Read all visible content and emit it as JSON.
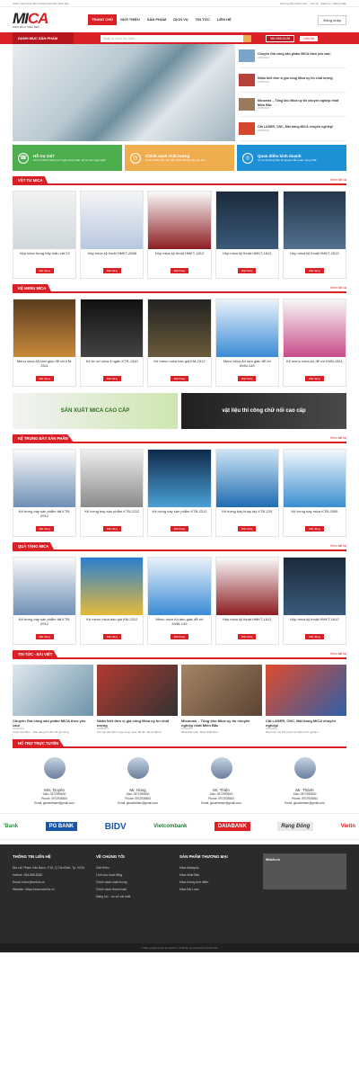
{
  "topbar": {
    "tagline": "Chào mừng bạn đến với thế giới biển Mica đẹp",
    "links": "Hướng dẫn thanh toán · Liên hệ · Đăng ký · Đăng nhập"
  },
  "logo": {
    "brand_a": "MI",
    "brand_b": "CA",
    "sub": "BIỂN MICA SIÊU ĐẸP"
  },
  "nav": [
    "TRANG CHỦ",
    "GIỚI THIỆU",
    "SẢN PHẨM",
    "DỊCH VỤ",
    "TIN TỨC",
    "LIÊN HỆ"
  ],
  "login_label": "Đăng nhập",
  "categories_label": "DANH MỤC SẢN PHẨM",
  "search_placeholder": "Nhập từ khóa tìm kiếm...",
  "hotline": "084.888.83.85",
  "cta": "Liên hệ",
  "sidenews": [
    {
      "title": "Chuyên Gia công sản phẩm MICA theo yêu cầu!",
      "date": "20/08/2019"
    },
    {
      "title": "Nhận biết đơn vị gia công Mica uy tín chất lượng",
      "date": "20/08/2019"
    },
    {
      "title": "Micomax – Tổng kho Mica uy tín chuyên nghiệp nhất Miền Bắc",
      "date": "20/08/2019"
    },
    {
      "title": "Cắt LASER, CNC, Mài bóng MICA chuyên nghiệp!",
      "date": "20/08/2019"
    }
  ],
  "features": [
    {
      "title": "Hỗ trợ 24/7",
      "desc": "Hỗ trợ khách hàng mọi ngày trong tuần, kể cả các ngày nghỉ"
    },
    {
      "title": "Chính sách chất lượng",
      "desc": "Hoàn 100% tiền nếu sản phẩm không đạt yêu cầu"
    },
    {
      "title": "Quan điểm kinh doanh",
      "desc": "Uy tín thương hiệu là nguyên tắc quan trọng nhất"
    }
  ],
  "more": "Xem tất cả",
  "order": "Đặt hàng",
  "sections": [
    {
      "title": "VẬT TƯ MICA",
      "items": [
        "Hộp mica trưng bày mẫu vật 23",
        "Hộp mica kỹ thuật HMKT-2808",
        "Hộp mica kỹ thuật HMKT-1812",
        "Hộp mica kỹ thuật HMKT-1612",
        "Hộp mica kỹ thuật HMKT-2512"
      ]
    },
    {
      "title": "KỆ MENU MICA",
      "items": [
        "Menu mica A5 tam giác để rời KM-2511",
        "Kệ tờ rơi mica 4 ngăn KTR-1510",
        "Kệ menu mica báo giá KM-2312",
        "Menu mica A4 tam giác để rời KMN-149",
        "Kệ menu mica A4 để rời KMN-2811"
      ]
    },
    {
      "title": "KỆ TRƯNG BÀY SẢN PHẨM",
      "items": [
        "Kệ trưng bày sản phẩm tất KTB-0912",
        "Kệ trưng bày sản phẩm KTB-2212",
        "Kệ trưng bày sản phẩm KTB-2312",
        "Kệ trưng bày khay tày KTB-225",
        "Kệ trưng bày mica KTB-2509"
      ]
    },
    {
      "title": "QUÀ TẶNG MICA",
      "items": [
        "Kệ trưng bày sản phẩm tất KTB-0912",
        "Kệ menu mica báo giá KM-2312",
        "Menu mica A4 tam giác để rời KMN-149",
        "Hộp mica kỹ thuật HMKT-1812",
        "Hộp mica kỹ thuật HMKT-1612"
      ]
    }
  ],
  "banners": [
    "SẢN XUẤT MICA CAO CẤP",
    "vật liệu thi công chữ nổi cao cấp"
  ],
  "news_title": "TIN TỨC - BÀI VIẾT",
  "news": [
    {
      "title": "Chuyên Gia công sản phẩm MICA theo yêu cầu!",
      "date": "20/08/2019",
      "snip": "Chào Các Bạn – Bạn đang tìm địa chỉ gia công..."
    },
    {
      "title": "Nhận biết đơn vị gia công Mica uy tín chất lượng",
      "date": "20/08/2019",
      "snip": "Khi bạn cần đến in gia công mica, để làm Menu MICA..."
    },
    {
      "title": "Micomax – Tổng kho Mica uy tín chuyên nghiệp nhất Miền Bắc",
      "date": "20/08/2019",
      "snip": "Mica Đài Loan, Mica Nhật Bản..."
    },
    {
      "title": "Cắt LASER, CNC, Mài bóng MICA chuyên nghiệp!",
      "date": "20/08/2019",
      "snip": "Micomax với thế mạnh là nhiều kinh nghiệm..."
    }
  ],
  "support_title": "HỖ TRỢ TRỰC TUYẾN",
  "staff": [
    {
      "name": "Mrs. Duyên",
      "zalo": "Zalo: 0972939830",
      "phone": "Phone: 0972939383",
      "email": "Email: giuseletham@gmail.com"
    },
    {
      "name": "Mr. Hùng",
      "zalo": "Zalo: 0972939830",
      "phone": "Phone: 0972939383",
      "email": "Email: giuseletham@gmail.com"
    },
    {
      "name": "Mr. Thiện",
      "zalo": "Zalo: 0972939830",
      "phone": "Phone: 0972939383",
      "email": "Email: giuseletham@gmail.com"
    },
    {
      "name": "Mr. Thành",
      "zalo": "Zalo: 0972939830",
      "phone": "Phone: 0972939383",
      "email": "Email: giuseletham@gmail.com"
    }
  ],
  "partners": [
    "'Bank",
    "PG BANK",
    "BIDV",
    "Vietcombank",
    "DAIABANK",
    "Rạng Đông",
    "Vietin"
  ],
  "footer": {
    "col1_title": "THÔNG TIN LIÊN HỆ",
    "col1": [
      "Địa chỉ: Phạm Văn Bạch, P.15, Q.Tân Bình, Tp. HCM",
      "Hotline: 084.888.8285",
      "Email: hotro@web2s.vn",
      "Website: https://www.web2s.vn"
    ],
    "col2_title": "VỀ CHÚNG TÔI",
    "col2": [
      "Giới thiệu",
      "Lĩnh vực hoạt động",
      "Chính sách chất lượng",
      "Chính sách thanh toán",
      "Năng lực - cơ sở vật chất"
    ],
    "col3_title": "SẢN PHẨM THƯƠNG MẠI",
    "col3": [
      "Mica Malaysia",
      "Mica Nhật Bản",
      "Mica không thời điểm",
      "Mica Đài Loan"
    ],
    "fb_title": "Web2s.vn"
  },
  "copyright": "© Bản quyền thuộc về Web2s | Thiết kế và phát triển bởi Web2s"
}
